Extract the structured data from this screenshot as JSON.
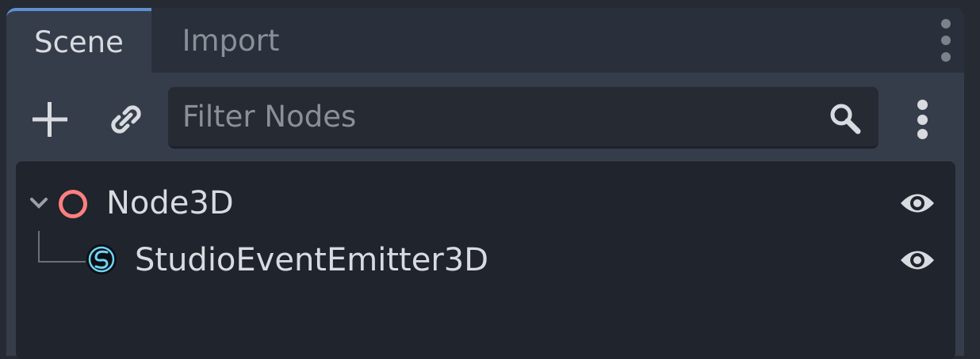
{
  "tabs": [
    {
      "label": "Scene",
      "active": true
    },
    {
      "label": "Import",
      "active": false
    }
  ],
  "toolbar": {
    "add_icon": "plus-icon",
    "link_icon": "link-icon",
    "filter_placeholder": "Filter Nodes",
    "search_icon": "search-icon",
    "menu_icon": "vertical-dots-icon"
  },
  "tree": [
    {
      "label": "Node3D",
      "icon": "node3d-ring-icon",
      "expanded": true,
      "visible": true
    },
    {
      "label": "StudioEventEmitter3D",
      "icon": "fmod-emitter-icon",
      "visible": true
    }
  ],
  "colors": {
    "accent": "#5e8fd1",
    "node3d": "#fc7f7f",
    "fmod": "#6fd4f4"
  }
}
